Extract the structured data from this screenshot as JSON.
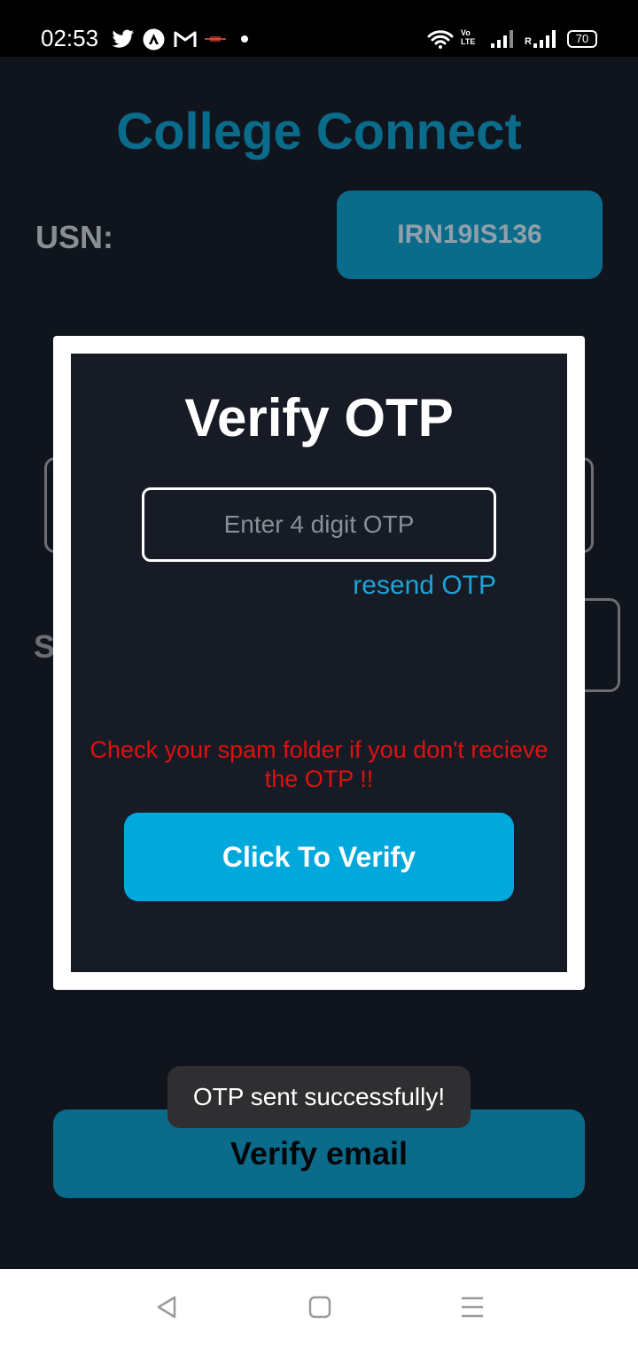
{
  "status_bar": {
    "time": "02:53",
    "icons": [
      "twitter-icon",
      "app-a-icon",
      "gmail-icon",
      "app-small-icon",
      "dot-icon",
      "wifi-icon",
      "volte-icon",
      "signal-1-icon",
      "signal-2-icon",
      "battery-icon"
    ],
    "volte_text": "Vo LTE",
    "roaming_text": "R",
    "battery": "70"
  },
  "app": {
    "title": "College Connect",
    "usn_label": "USN:",
    "usn_value": "IRN19IS136",
    "partial_label": "S",
    "verify_email_label": "Verify email"
  },
  "modal": {
    "title": "Verify OTP",
    "otp_placeholder": "Enter 4 digit OTP",
    "otp_value": "",
    "resend_label": "resend OTP",
    "spam_note": "Check your spam folder if you don't recieve the OTP !!",
    "verify_button": "Click To Verify"
  },
  "toast": {
    "message": "OTP sent successfully!"
  },
  "nav": {
    "icons": [
      "back-icon",
      "home-icon",
      "recents-icon"
    ]
  },
  "colors": {
    "accent": "#00a8dc",
    "accent_dark": "#0b6b8a",
    "warning": "#e0110f",
    "link": "#1ea3d6",
    "modal_bg": "#161b26"
  }
}
